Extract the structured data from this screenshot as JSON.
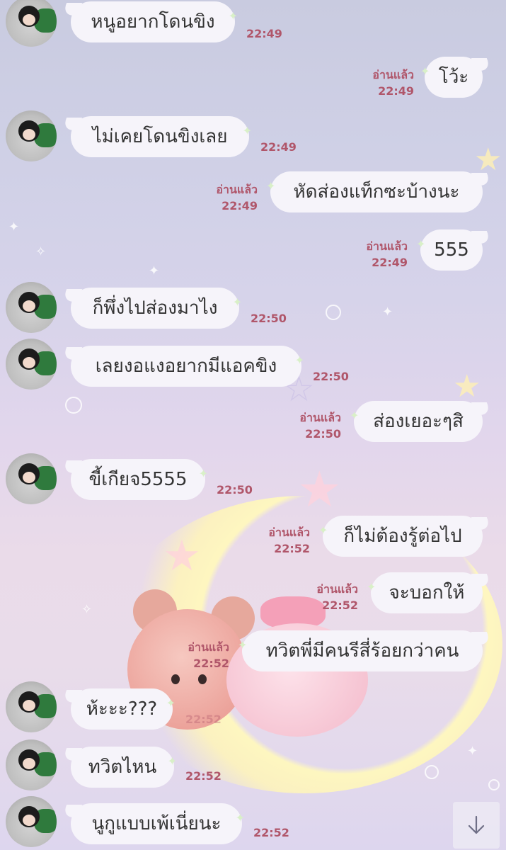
{
  "read_label": "อ่านแล้ว",
  "colors": {
    "accent": "#b0566a",
    "bubble": "#f6f4fa"
  },
  "messages": [
    {
      "dir": "in",
      "text": "หนูอยากโดนขิง",
      "time": "22:49"
    },
    {
      "dir": "out",
      "text": "โว้ะ",
      "time": "22:49",
      "read": "อ่านแล้ว"
    },
    {
      "dir": "in",
      "text": "ไม่เคยโดนขิงเลย",
      "time": "22:49"
    },
    {
      "dir": "out",
      "text": "หัดส่องแท็กซะบ้างนะ",
      "time": "22:49",
      "read": "อ่านแล้ว"
    },
    {
      "dir": "out",
      "text": "555",
      "time": "22:49",
      "read": "อ่านแล้ว"
    },
    {
      "dir": "in",
      "text": "ก็พึ่งไปส่องมาไง",
      "time": "22:50"
    },
    {
      "dir": "in",
      "text": "เลยงอแงอยากมีแอคขิง",
      "time": "22:50"
    },
    {
      "dir": "out",
      "text": "ส่องเยอะๆสิ",
      "time": "22:50",
      "read": "อ่านแล้ว"
    },
    {
      "dir": "in",
      "text": "ขี้เกียจ5555",
      "time": "22:50"
    },
    {
      "dir": "out",
      "text": "ก็ไม่ต้องรู้ต่อไป",
      "time": "22:52",
      "read": "อ่านแล้ว"
    },
    {
      "dir": "out",
      "text": "จะบอกให้",
      "time": "22:52",
      "read": "อ่านแล้ว"
    },
    {
      "dir": "out",
      "text": "ทวิตพี่มีคนรีสี่ร้อยกว่าคน",
      "time": "22:52",
      "read": "อ่านแล้ว"
    },
    {
      "dir": "in",
      "text": "ห้ะะะ???",
      "time": "22:52"
    },
    {
      "dir": "in",
      "text": "ทวิตไหน",
      "time": "22:52"
    },
    {
      "dir": "in",
      "text": "นูกูแบบเพ้เนี่ยนะ",
      "time": "22:52"
    }
  ],
  "icons": {
    "scroll_down": "arrow-down-icon",
    "avatar": "contact-avatar",
    "deco": "sparkle-icon"
  }
}
